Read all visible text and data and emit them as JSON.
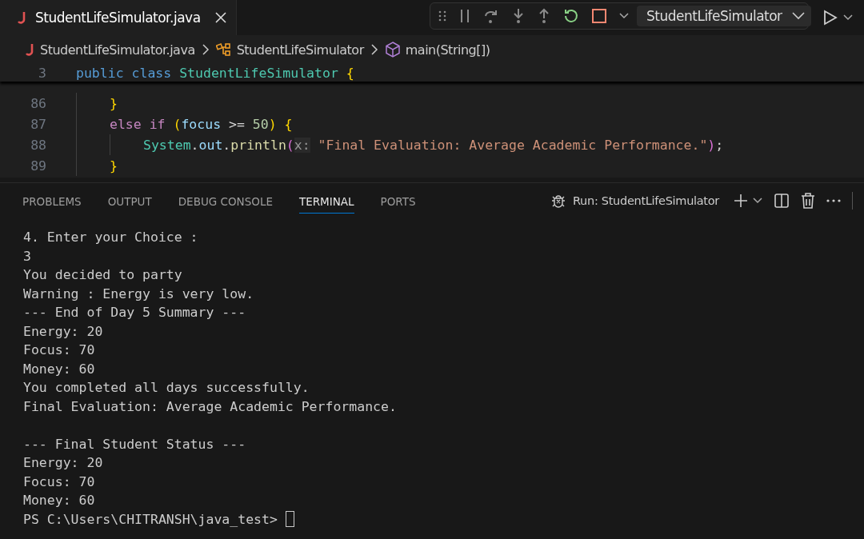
{
  "tabs": [
    {
      "label": "StudentLifeSimulator.java",
      "selected": true
    }
  ],
  "debug_toolbar": {
    "config": "StudentLifeSimulator"
  },
  "breadcrumbs": [
    "StudentLifeSimulator.java",
    "StudentLifeSimulator",
    "main(String[])"
  ],
  "sticky_line": {
    "number": "3",
    "tokens": [
      {
        "kind": "keyword",
        "text": "public class"
      },
      {
        "kind": "type",
        "text": "StudentLifeSimulator",
        "gap": true
      },
      {
        "kind": "brace",
        "text": "{",
        "gap": true
      }
    ]
  },
  "code_lines": [
    {
      "number": "86",
      "tokens": [
        {
          "kind": "brace",
          "text": "}"
        }
      ]
    },
    {
      "number": "87",
      "tokens": [
        {
          "kind": "control",
          "text": "else if"
        },
        {
          "kind": "brace",
          "text": "(",
          "gap": true
        },
        {
          "kind": "var",
          "text": "focus"
        },
        {
          "kind": "plain",
          "text": ">=",
          "gap": true
        },
        {
          "kind": "number",
          "text": "50",
          "gap": true
        },
        {
          "kind": "brace",
          "text": ")"
        },
        {
          "kind": "brace",
          "text": "{",
          "gap": true
        }
      ],
      "children": [
        {
          "number": "88",
          "tokens": [
            {
              "kind": "type",
              "text": "System"
            },
            {
              "kind": "plain",
              "text": "."
            },
            {
              "kind": "var",
              "text": "out"
            },
            {
              "kind": "plain",
              "text": "."
            },
            {
              "kind": "func",
              "text": "println"
            },
            {
              "kind": "paren",
              "text": "("
            },
            {
              "kind": "hint",
              "text": "x:"
            },
            {
              "kind": "string",
              "text": "\"Final Evaluation: Average Academic Performance.\"",
              "gap": true
            },
            {
              "kind": "paren",
              "text": ")"
            },
            {
              "kind": "plain",
              "text": ";"
            }
          ]
        }
      ]
    },
    {
      "number": "89",
      "tokens": [
        {
          "kind": "brace",
          "text": "}"
        }
      ]
    }
  ],
  "panel_tabs": [
    {
      "label": "PROBLEMS",
      "selected": false
    },
    {
      "label": "OUTPUT",
      "selected": false
    },
    {
      "label": "DEBUG CONSOLE",
      "selected": false
    },
    {
      "label": "TERMINAL",
      "selected": true
    },
    {
      "label": "PORTS",
      "selected": false
    }
  ],
  "terminal_name": "Run: StudentLifeSimulator",
  "terminal_lines": [
    {
      "text": "4. Enter your Choice :"
    },
    {
      "text": "3"
    },
    {
      "text": "You decided to party"
    },
    {
      "text": "Warning : Energy is very low."
    },
    {
      "text": "--- End of Day 5 Summary ---"
    },
    {
      "text": "Energy: 20"
    },
    {
      "text": "Focus: 70"
    },
    {
      "text": "Money: 60"
    },
    {
      "text": "You completed all days successfully."
    },
    {
      "text": "Final Evaluation: Average Academic Performance."
    },
    {
      "text": "--- Final Student Status ---",
      "blank_before": true
    },
    {
      "text": "Energy: 20"
    },
    {
      "text": "Focus: 70"
    },
    {
      "text": "Money: 60"
    }
  ],
  "prompt": "PS C:\\Users\\CHITRANSH\\java_test>"
}
